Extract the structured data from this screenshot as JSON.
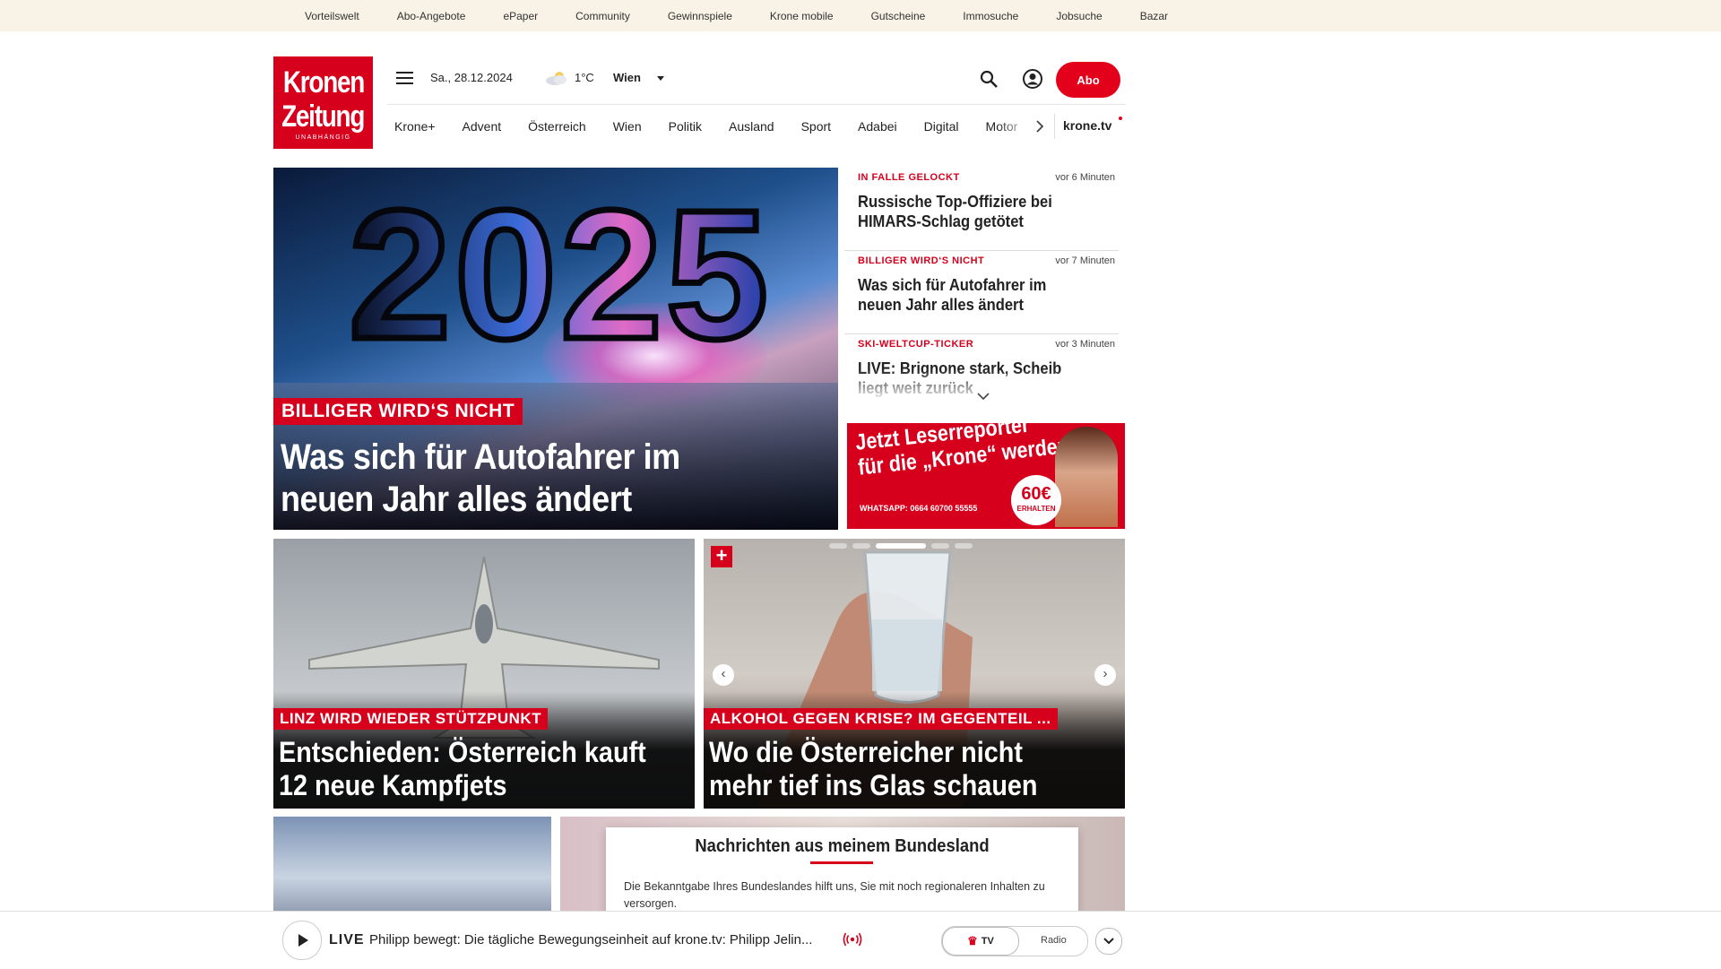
{
  "top_links": [
    "Vorteilswelt",
    "Abo-Angebote",
    "ePaper",
    "Community",
    "Gewinnspiele",
    "Krone mobile",
    "Gutscheine",
    "Immosuche",
    "Jobsuche",
    "Bazar"
  ],
  "logo": {
    "line1": "Kronen",
    "line2": "Zeitung",
    "line3": "UNABHÄNGIG"
  },
  "header": {
    "date": "Sa., 28.12.2024",
    "temperature": "1°C",
    "city": "Wien",
    "abo_label": "Abo"
  },
  "nav": {
    "items": [
      "Krone+",
      "Advent",
      "Österreich",
      "Wien",
      "Politik",
      "Ausland",
      "Sport",
      "Adabei",
      "Digital",
      "Motor"
    ],
    "tv_label": "krone.tv"
  },
  "hero": {
    "year": "2025",
    "kicker": "BILLIGER WIRD‘S NICHT",
    "title": "Was sich für Autofahrer im neuen Jahr alles ändert"
  },
  "teasers": [
    {
      "kicker": "IN FALLE GELOCKT",
      "time": "vor 6 Minuten",
      "title": "Russische Top-Offiziere bei HIMARS-Schlag getötet"
    },
    {
      "kicker": "BILLIGER WIRD‘S NICHT",
      "time": "vor 7 Minuten",
      "title": "Was sich für Autofahrer im neuen Jahr alles ändert"
    },
    {
      "kicker": "SKI-WELTCUP-TICKER",
      "time": "vor 3 Minuten",
      "title": "LIVE: Brignone stark, Scheib liegt weit zurück"
    }
  ],
  "ad": {
    "headline_line1": "Jetzt Leserreporter",
    "headline_line2": "für die „Krone“ werden",
    "whatsapp": "WHATSAPP: 0664 60700 55555",
    "amount": "60€",
    "amount_note": "ERHALTEN"
  },
  "cards": [
    {
      "kicker": "LINZ WIRD WIEDER STÜTZPUNKT",
      "title": "Entschieden: Österreich kauft 12 neue Kampfjets"
    },
    {
      "kicker": "ALKOHOL GEGEN KRISE? IM GEGENTEIL ...",
      "title": "Wo die Österreicher nicht mehr tief ins Glas schauen"
    }
  ],
  "region_popup": {
    "title": "Nachrichten aus meinem Bundesland",
    "text": "Die Bekanntgabe Ihres Bundeslandes hilft uns, Sie mit noch regionaleren Inhalten zu versorgen."
  },
  "player": {
    "live_label": "LIVE",
    "now_playing": "Philipp bewegt: Die tägliche Bewegungseinheit auf krone.tv: Philipp Jelin...",
    "tv_label": "TV",
    "radio_label": "Radio"
  },
  "colors": {
    "brand_red": "#d6001c",
    "abo_red": "#e2001a",
    "topbar_bg": "#f8f3e6"
  },
  "icons": [
    "menu-icon",
    "weather-cloud-icon",
    "caret-down-icon",
    "search-icon",
    "user-icon",
    "chevron-right-icon",
    "chevron-down-icon",
    "plus-icon",
    "arrow-left-icon",
    "arrow-right-icon",
    "play-icon",
    "radio-waves-icon",
    "crown-icon",
    "expand-icon"
  ]
}
